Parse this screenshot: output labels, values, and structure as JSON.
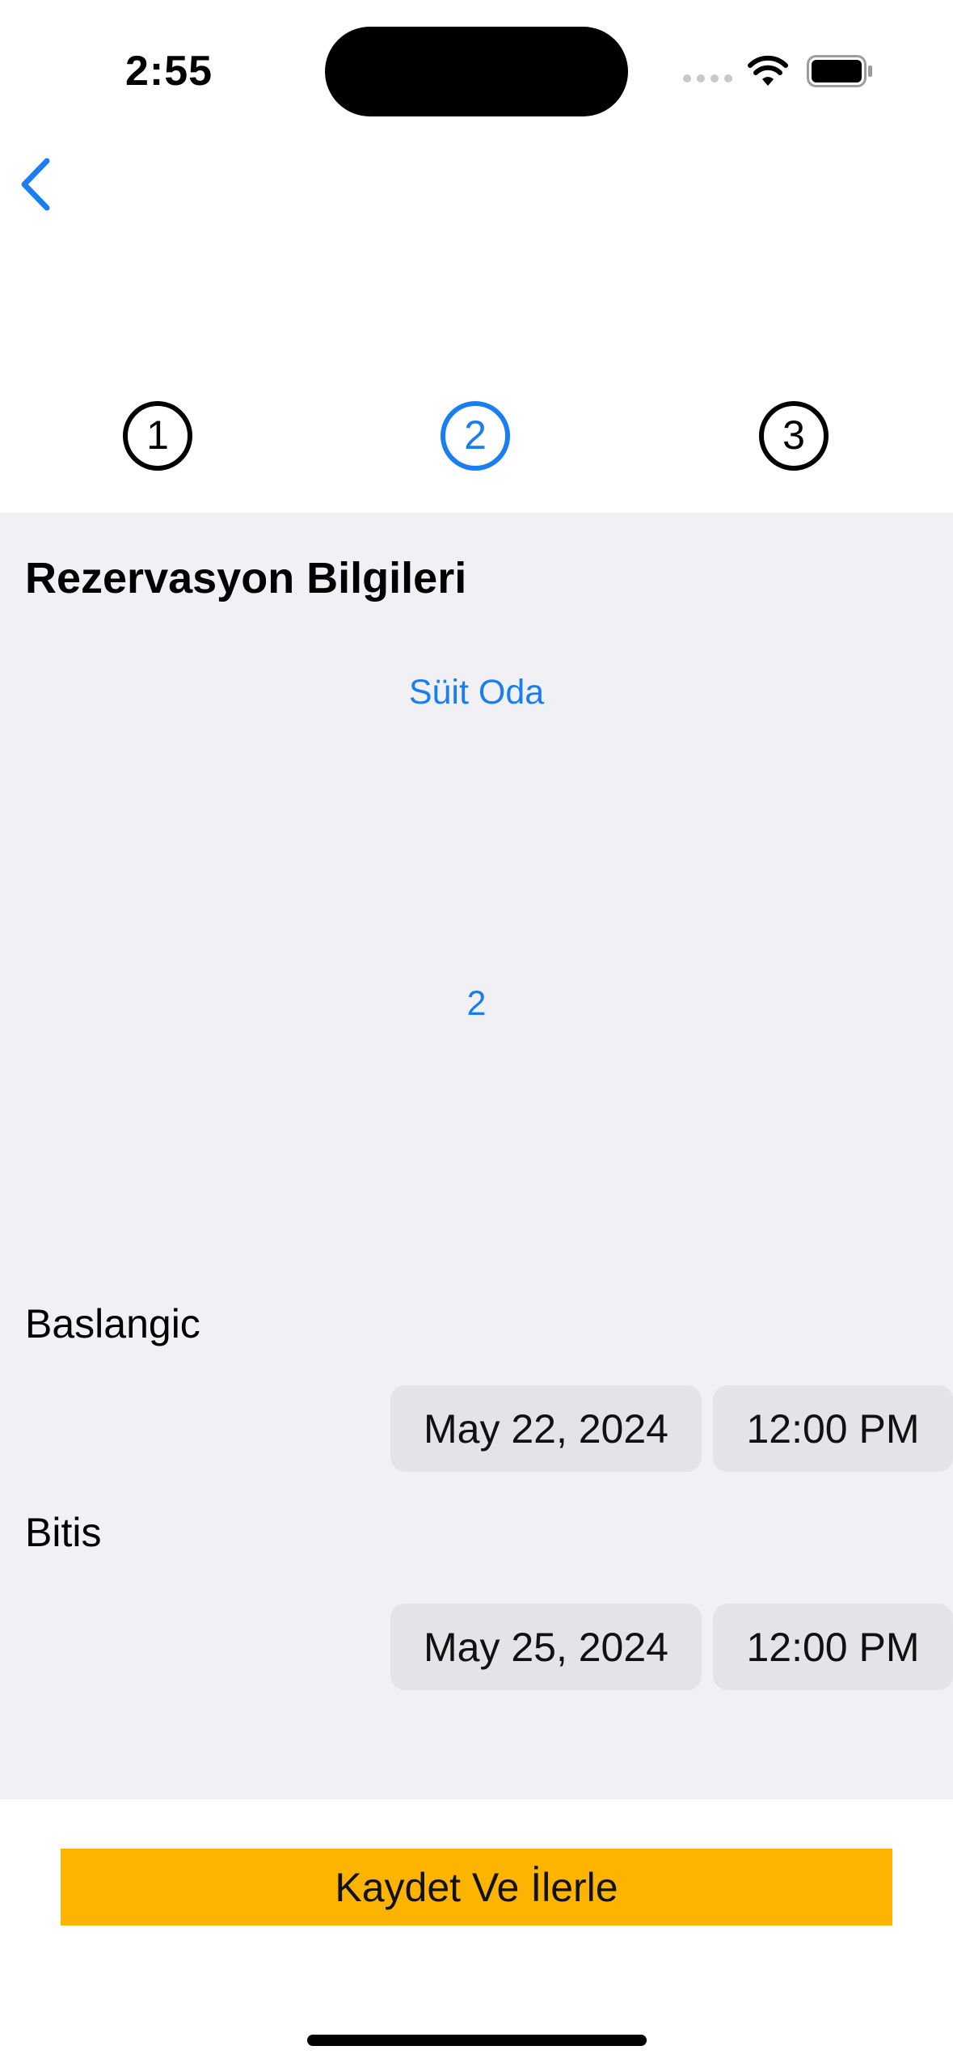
{
  "status_bar": {
    "time": "2:55",
    "icons": [
      "cellular-signal-icon",
      "wifi-icon",
      "battery-icon"
    ]
  },
  "nav": {
    "back_icon": "chevron-left-icon"
  },
  "stepper": {
    "steps": [
      {
        "number": "1",
        "state": "inactive"
      },
      {
        "number": "2",
        "state": "active"
      },
      {
        "number": "3",
        "state": "inactive"
      }
    ],
    "active_color": "#1a7ef0"
  },
  "form": {
    "title": "Rezervasyon Bilgileri",
    "room_type": "Süit Oda",
    "guest_count": "2",
    "start": {
      "label": "Baslangic",
      "date": "May 22, 2024",
      "time": "12:00 PM"
    },
    "end": {
      "label": "Bitis",
      "date": "May 25, 2024",
      "time": "12:00 PM"
    }
  },
  "cta": {
    "label": "Kaydet Ve İlerle",
    "color": "#fdb400"
  },
  "colors": {
    "accent": "#1a7ef0",
    "panel_bg": "#f1f1f5",
    "pill_bg": "#e3e3e8"
  }
}
